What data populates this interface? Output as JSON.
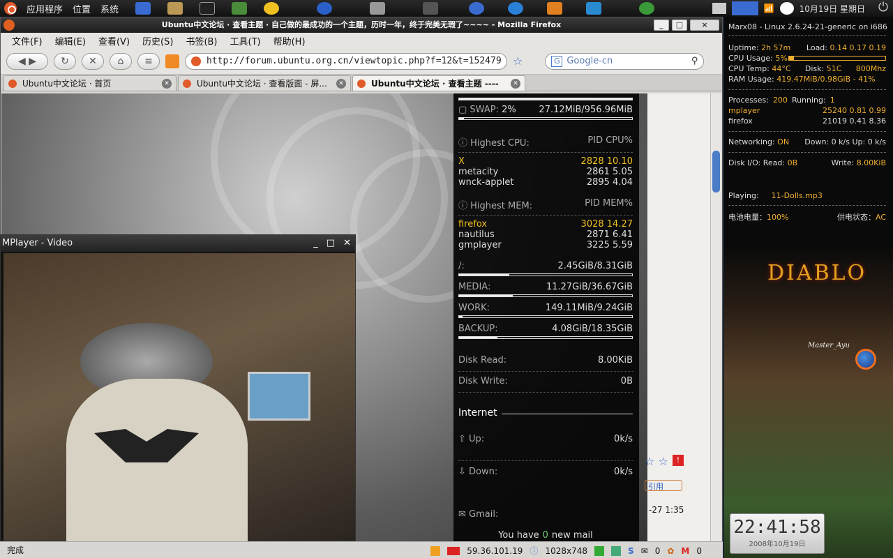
{
  "panel": {
    "apps": "应用程序",
    "places": "位置",
    "system": "系统",
    "date": "10月19日 星期日"
  },
  "firefox": {
    "title": "Ubuntu中文论坛 · 查看主题 · 自己做的最成功的一个主题，历时一年，终于完美无瑕了~~~~ - Mozilla Firefox",
    "menu": [
      "文件(F)",
      "编辑(E)",
      "查看(V)",
      "历史(S)",
      "书签(B)",
      "工具(T)",
      "帮助(H)"
    ],
    "url": "http://forum.ubuntu.org.cn/viewtopic.php?f=12&t=152479",
    "search_placeholder": "Google-cn",
    "tabs": [
      {
        "label": "Ubuntu中文论坛 · 首页"
      },
      {
        "label": "Ubuntu中文论坛 · 查看版面 - 屏..."
      },
      {
        "label": "Ubuntu中文论坛 · 查看主题 ----"
      }
    ],
    "status": "完成",
    "ip": "59.36.101.19",
    "resolution": "1028x748",
    "mail_count": "0",
    "gmail_count": "0",
    "page_snippet_reply": "引用",
    "page_snippet_time": "-27 1:35"
  },
  "mplayer": {
    "title": "MPlayer - Video"
  },
  "conky": {
    "swap_label": "SWAP:",
    "swap_pct": "2%",
    "swap_val": "27.12MiB/956.96MiB",
    "swap_fill": 0.03,
    "high_cpu": "Highest CPU:",
    "cpu_cols": "PID  CPU%",
    "cpu_procs": [
      {
        "name": "X",
        "pid": "2828",
        "val": "10.10"
      },
      {
        "name": "metacity",
        "pid": "2861",
        "val": "5.05"
      },
      {
        "name": "wnck-applet",
        "pid": "2895",
        "val": "4.04"
      }
    ],
    "high_mem": "Highest MEM:",
    "mem_cols": "PID  MEM%",
    "mem_procs": [
      {
        "name": "firefox",
        "pid": "3028",
        "val": "14.27"
      },
      {
        "name": "nautilus",
        "pid": "2871",
        "val": "6.41"
      },
      {
        "name": "gmplayer",
        "pid": "3225",
        "val": "5.59"
      }
    ],
    "disks": [
      {
        "label": "/:",
        "val": "2.45GiB/8.31GiB",
        "fill": 0.29
      },
      {
        "label": "MEDIA:",
        "val": "11.27GiB/36.67GiB",
        "fill": 0.31
      },
      {
        "label": "WORK:",
        "val": "149.11MiB/9.24GiB",
        "fill": 0.02
      },
      {
        "label": "BACKUP:",
        "val": "4.08GiB/18.35GiB",
        "fill": 0.22
      }
    ],
    "disk_read_label": "Disk Read:",
    "disk_read": "8.00KiB",
    "disk_write_label": "Disk Write:",
    "disk_write": "0B",
    "internet": "Internet",
    "up_label": "Up:",
    "up": "0k/s",
    "down_label": "Down:",
    "down": "0k/s",
    "gmail": "Gmail:",
    "mail_pre": "You have",
    "mail_n": "0",
    "mail_post": "new mail"
  },
  "sys": {
    "host": "Marx08 - Linux 2.6.24-21-generic on i686",
    "uptime_label": "Uptime:",
    "uptime": "2h 57m",
    "load_label": "Load:",
    "load": "0.14  0.17  0.19",
    "cpu_usage_label": "CPU Usage:",
    "cpu_usage": "5%",
    "cpu_fill": 0.05,
    "cpu_temp_label": "CPU Temp:",
    "cpu_temp": "44°C",
    "disk_temp_label": "Disk:",
    "disk_temp": "51C",
    "freq": "800Mhz",
    "ram_label": "RAM Usage:",
    "ram": "419.47MiB/0.98GiB - 41%",
    "processes_label": "Processes:",
    "processes": "200",
    "running_label": "Running:",
    "running": "1",
    "procs": [
      {
        "name": "mplayer",
        "pid": "25240",
        "cpu": "0.81",
        "mem": "0.99"
      },
      {
        "name": "firefox",
        "pid": "21019",
        "cpu": "0.41",
        "mem": "8.36"
      }
    ],
    "net_label": "Networking:",
    "net": "ON",
    "net_rate": "Down: 0 k/s  Up: 0 k/s",
    "disk_io_label": "Disk I/O: Read:",
    "disk_io_read": "0B",
    "disk_io_write_label": "Write:",
    "disk_io_write": "8.00KiB",
    "playing_label": "Playing:",
    "playing": "11-Dolls.mp3",
    "battery_label": "电池电量：",
    "battery": "100%",
    "power_label": "供电状态：",
    "power": "AC",
    "game_logo": "DIABLO",
    "signature": "Master_Ayu"
  },
  "clock": {
    "time": "22:41:58",
    "date": "2008年10月19日"
  }
}
